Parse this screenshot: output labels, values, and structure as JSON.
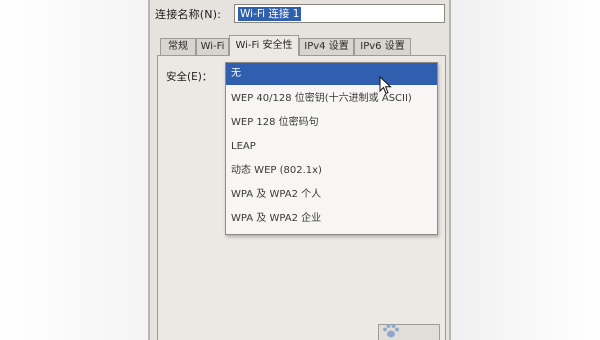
{
  "window": {
    "connection_name_label": "连接名称(N):",
    "connection_name_value": "Wi-Fi 连接 1"
  },
  "tabs": [
    {
      "label": "常规",
      "active": false
    },
    {
      "label": "Wi-Fi",
      "active": false
    },
    {
      "label": "Wi-Fi 安全性",
      "active": true
    },
    {
      "label": "IPv4 设置",
      "active": false
    },
    {
      "label": "IPv6 设置",
      "active": false
    }
  ],
  "security": {
    "label": "安全(E)：",
    "options": [
      "无",
      "WEP 40/128 位密钥(十六进制或 ASCII)",
      "WEP 128 位密码句",
      "LEAP",
      "动态 WEP (802.1x)",
      "WPA 及 WPA2 个人",
      "WPA 及 WPA2 企业"
    ],
    "selected_index": 0
  },
  "colors": {
    "selection": "#2f5fae",
    "window_bg": "#e6e2de"
  },
  "icons": {
    "cursor": "mouse-pointer-icon",
    "watermark": "paw-watermark-icon"
  }
}
